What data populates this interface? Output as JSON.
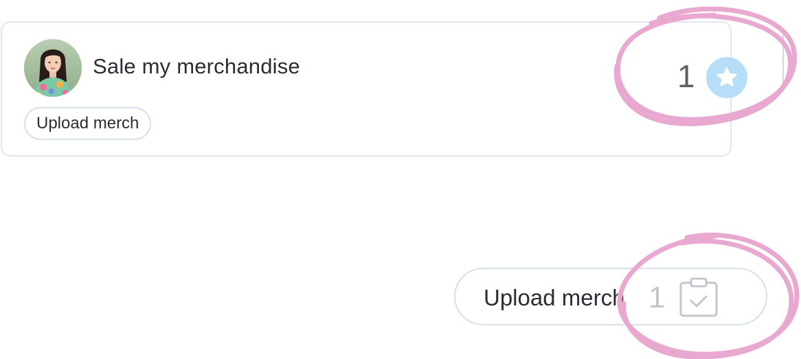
{
  "card": {
    "title": "Sale my merchandise",
    "tag_label": "Upload merch",
    "star_count": "1",
    "avatar_icon": "person-avatar",
    "star_icon": "star-icon"
  },
  "action": {
    "label": "Upload merch",
    "count": "1",
    "icon": "clipboard-check-icon"
  },
  "colors": {
    "highlight": "#e9a8cf",
    "star_badge": "#b6def8",
    "pill_border": "#d7e0ea",
    "text": "#2a2d33"
  }
}
